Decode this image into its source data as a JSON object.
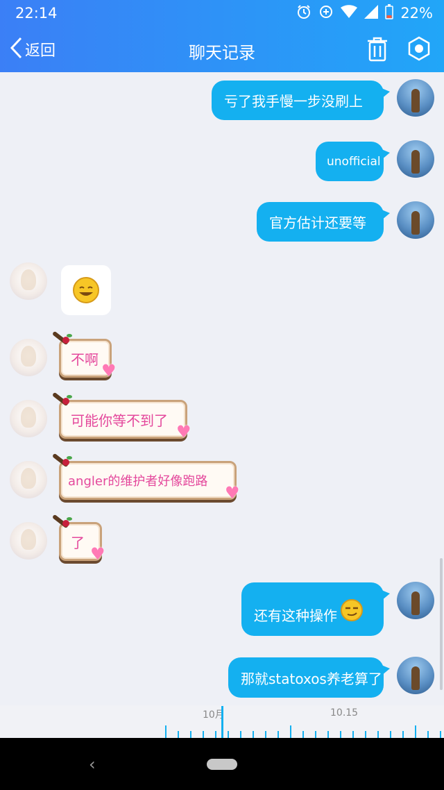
{
  "status_bar": {
    "time": "22:14",
    "battery": "22%",
    "icons": [
      "alarm-icon",
      "data-saver-icon",
      "wifi-icon",
      "signal-icon",
      "battery-icon"
    ]
  },
  "header": {
    "back_label": "返回",
    "title": "聊天记录",
    "actions": [
      "trash-icon",
      "settings-icon"
    ]
  },
  "messages": [
    {
      "side": "right",
      "text": "亏了我手慢一步没刷上"
    },
    {
      "side": "right",
      "text": "unofficial"
    },
    {
      "side": "right",
      "text": "官方估计还要等"
    },
    {
      "side": "left",
      "type": "sticker",
      "icon": "smile-emoji-icon"
    },
    {
      "side": "left",
      "text": "不啊"
    },
    {
      "side": "left",
      "text": "可能你等不到了"
    },
    {
      "side": "left",
      "text": "angler的维护者好像跑路"
    },
    {
      "side": "left",
      "text": "了"
    },
    {
      "side": "right",
      "text": "还有这种操作",
      "emoji": "smirk-emoji-icon"
    },
    {
      "side": "right",
      "text": "那就statoxos养老算了"
    }
  ],
  "timeline": {
    "labels": [
      "10月",
      "10.15"
    ]
  },
  "colors": {
    "header_start": "#3b7ff6",
    "header_end": "#21a6f8",
    "bubble_right": "#14b0f0",
    "bubble_left_text": "#e4489c",
    "background": "#eef0f6"
  }
}
